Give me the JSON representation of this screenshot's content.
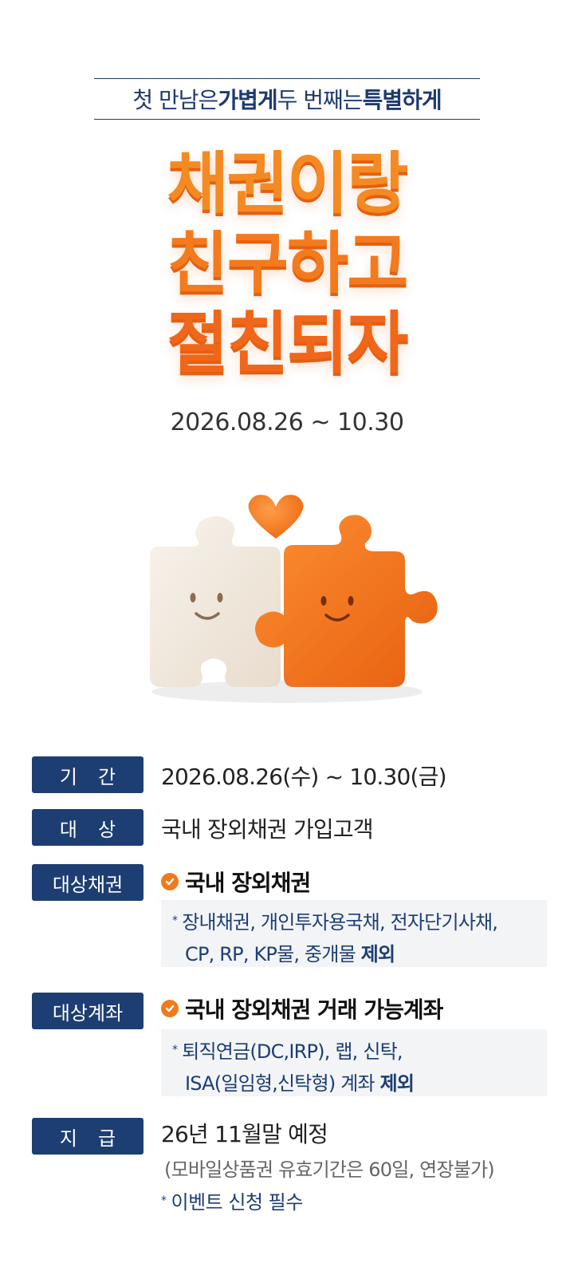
{
  "header": {
    "subtitle_a": "첫 만남은 ",
    "subtitle_b": "가볍게",
    "subtitle_c": " 두 번째는 ",
    "subtitle_d": "특별하게"
  },
  "headline": {
    "line1": "채권이랑",
    "line2": "친구하고",
    "line3": "절친되자"
  },
  "period_main": "2026.08.26 ~ 10.30",
  "info": {
    "period": {
      "label": "기간",
      "value": "2026.08.26(수) ~ 10.30(금)"
    },
    "target": {
      "label": "대상",
      "value": "국내 장외채권 가입고객"
    },
    "bonds": {
      "label": "대상채권",
      "title": "국내 장외채권",
      "note_star": "*",
      "note_line1": "장내채권, 개인투자용국채, 전자단기사채,",
      "note_line2": "CP, RP, KP물, 중개물 ",
      "note_excl": "제외"
    },
    "accounts": {
      "label": "대상계좌",
      "title": "국내 장외채권 거래 가능계좌",
      "note_star": "*",
      "note_line1": "퇴직연금(DC,IRP), 랩, 신탁,",
      "note_line2": "ISA(일임형,신탁형) 계좌 ",
      "note_excl": "제외"
    },
    "payment": {
      "label": "지급",
      "value": "26년 11월말 예정",
      "sub": "(모바일상품권 유효기간은 60일, 연장불가)",
      "star": "*",
      "notice": "이벤트 신청 필수"
    }
  },
  "colors": {
    "navy": "#1d3e73",
    "orange": "#f47b20",
    "cream": "#f3ebe1"
  },
  "icons": [
    "heart-icon",
    "puzzle-illustration",
    "check-circle-icon"
  ]
}
